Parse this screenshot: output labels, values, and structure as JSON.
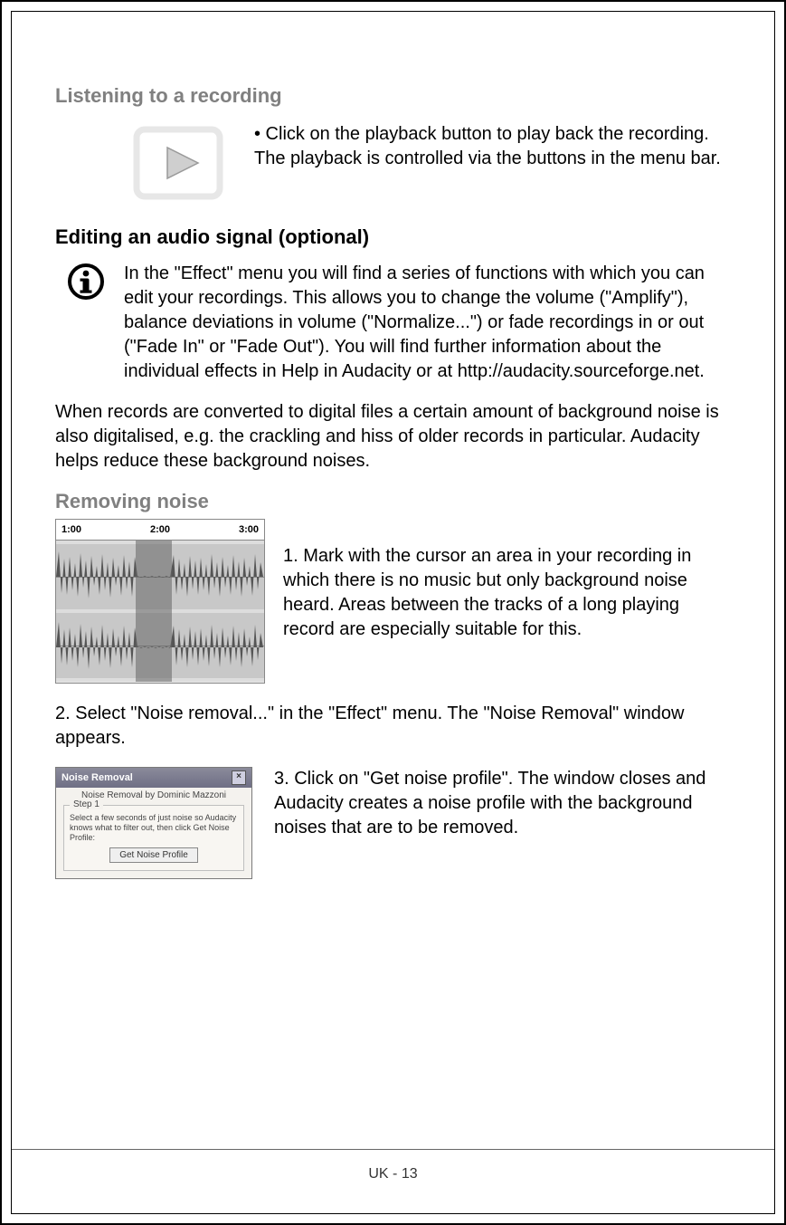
{
  "sections": {
    "listening": {
      "title": "Listening to a recording",
      "bullet": "• Click on the playback button to play back the recording. The playback is controlled via the buttons in the menu bar."
    },
    "editing": {
      "title": "Editing an audio signal (optional)",
      "info": "In the \"Effect\" menu you will find a series of functions with which you can edit your recordings. This allows you to change the volume (\"Amplify\"), balance deviations in volume (\"Normalize...\") or fade recordings in or out (\"Fade In\" or \"Fade Out\"). You will find further information about the individual effects in Help in Audacity or at http://audacity.sourceforge.net.",
      "para": "When records are converted to digital files a certain amount of background noise is also digitalised, e.g. the crackling and hiss of older records in particular. Audacity helps reduce these background noises."
    },
    "removing": {
      "title": "Removing noise",
      "ruler": {
        "t1": "1:00",
        "t2": "2:00",
        "t3": "3:00"
      },
      "step1": "1. Mark with the cursor an area in your recording in which there is no music but only background noise heard. Areas between the tracks of a long playing record are especially suitable for this.",
      "step2": "2. Select \"Noise removal...\" in the \"Effect\" menu. The \"Noise Removal\" window appears.",
      "step3": "3. Click on \"Get noise profile\". The window closes and Audacity creates a noise profile with the background noises that are to be removed."
    },
    "dialog": {
      "title": "Noise Removal",
      "subtitle": "Noise Removal by Dominic Mazzoni",
      "stepLabel": "Step 1",
      "stepText": "Select a few seconds of just noise so Audacity knows what to filter out, then click Get Noise Profile:",
      "button": "Get Noise Profile",
      "close": "×"
    }
  },
  "footer": "UK - 13"
}
